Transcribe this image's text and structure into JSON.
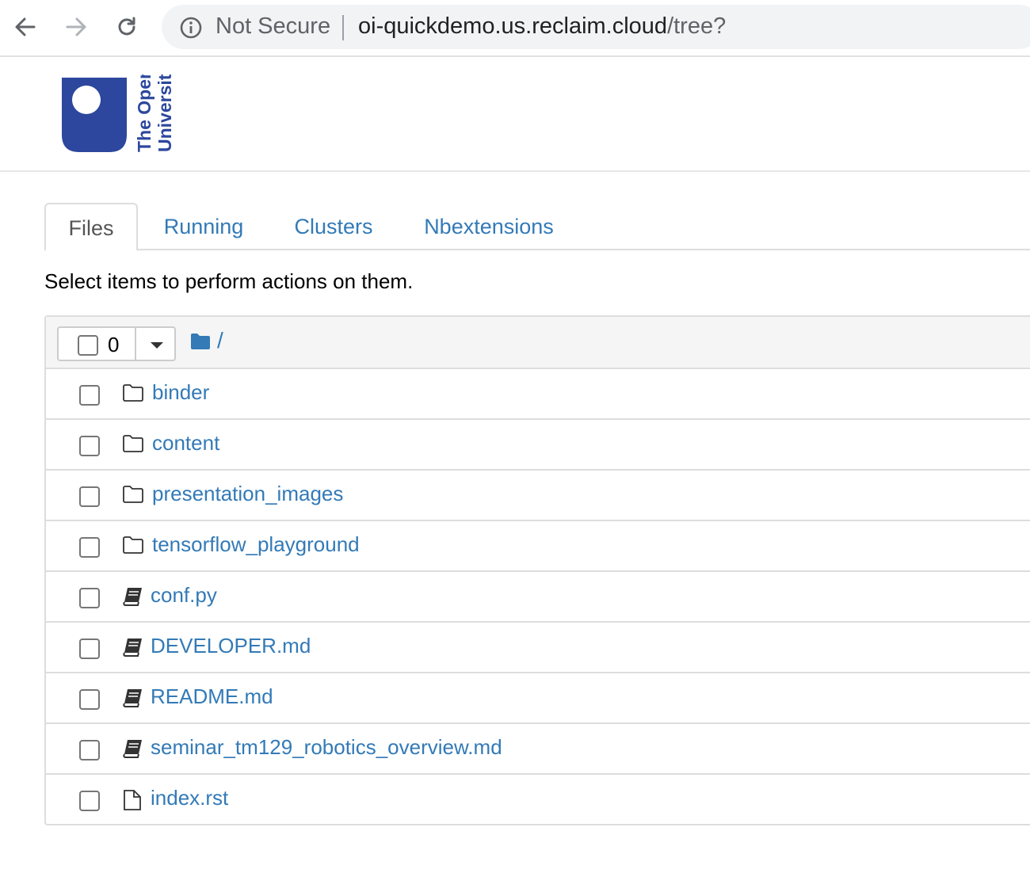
{
  "browser": {
    "security_label": "Not Secure",
    "url_host": "oi-quickdemo.us.reclaim.cloud",
    "url_path": "/tree?"
  },
  "logo": {
    "text_line1": "The Open",
    "text_line2": "University",
    "color": "#2c479d"
  },
  "tabs": [
    {
      "label": "Files",
      "active": true
    },
    {
      "label": "Running",
      "active": false
    },
    {
      "label": "Clusters",
      "active": false
    },
    {
      "label": "Nbextensions",
      "active": false
    }
  ],
  "hint": "Select items to perform actions on them.",
  "toolbar": {
    "selected_count": "0",
    "breadcrumb": "/"
  },
  "items": [
    {
      "name": "binder",
      "kind": "folder"
    },
    {
      "name": "content",
      "kind": "folder"
    },
    {
      "name": "presentation_images",
      "kind": "folder"
    },
    {
      "name": "tensorflow_playground",
      "kind": "folder"
    },
    {
      "name": "conf.py",
      "kind": "notebook-icon"
    },
    {
      "name": "DEVELOPER.md",
      "kind": "notebook-icon"
    },
    {
      "name": "README.md",
      "kind": "notebook-icon"
    },
    {
      "name": "seminar_tm129_robotics_overview.md",
      "kind": "notebook-icon"
    },
    {
      "name": "index.rst",
      "kind": "file"
    }
  ],
  "colors": {
    "link": "#337ab7",
    "border": "#dddddd"
  }
}
